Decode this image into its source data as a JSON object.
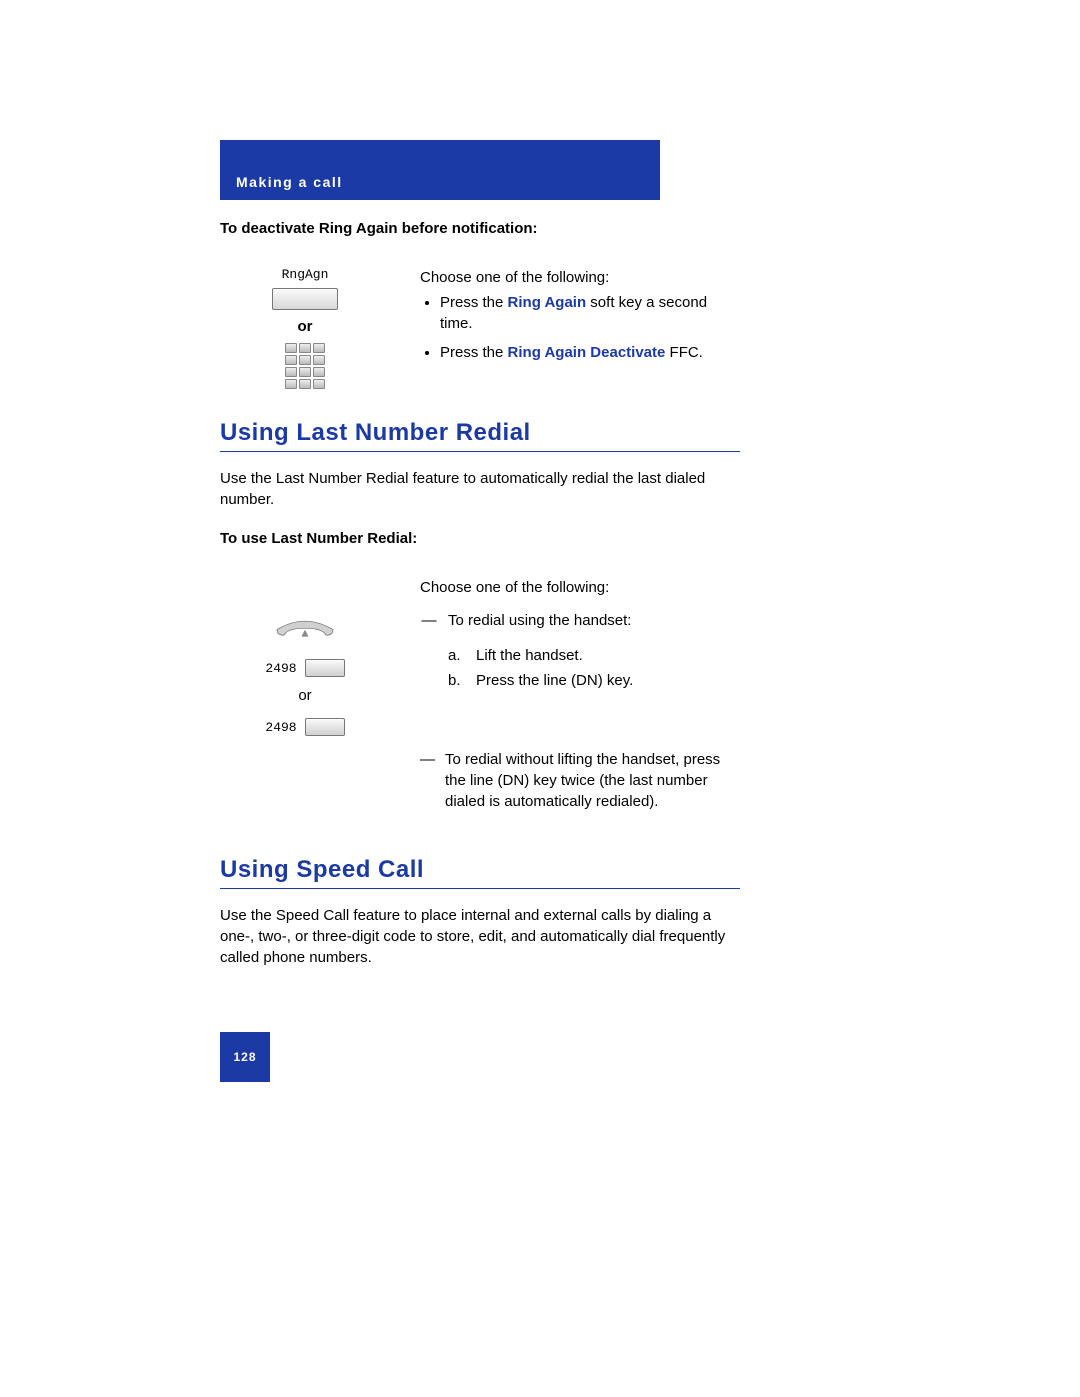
{
  "header": {
    "section_title": "Making a call"
  },
  "section1": {
    "title": "To deactivate Ring Again before notification:",
    "softkey_label": "RngAgn",
    "or": "or",
    "intro": "Choose one of the following:",
    "bullet1_pre": "Press the ",
    "bullet1_bold": "Ring Again",
    "bullet1_post": " soft key a second time.",
    "bullet2_pre": "Press the ",
    "bullet2_bold": "Ring Again Deactivate",
    "bullet2_post": " FFC."
  },
  "section2": {
    "heading": "Using Last Number Redial",
    "intro_para": "Use the Last Number Redial feature to automatically redial the last dialed number.",
    "subtitle": "To use Last Number Redial:",
    "linekey_num": "2498",
    "or": "or",
    "col_intro": "Choose one of the following:",
    "dash1": "To redial using the handset:",
    "a": "Lift the handset.",
    "b": "Press the line (DN) key.",
    "dash2": "To redial without lifting the handset, press the line (DN) key twice (the last number dialed is automatically redialed)."
  },
  "section3": {
    "heading": "Using Speed Call",
    "intro_para": "Use the Speed Call feature to place internal and external calls by dialing a one-, two-, or three-digit code to store, edit, and automatically dial frequently called phone numbers."
  },
  "footer": {
    "page_number": "128"
  }
}
